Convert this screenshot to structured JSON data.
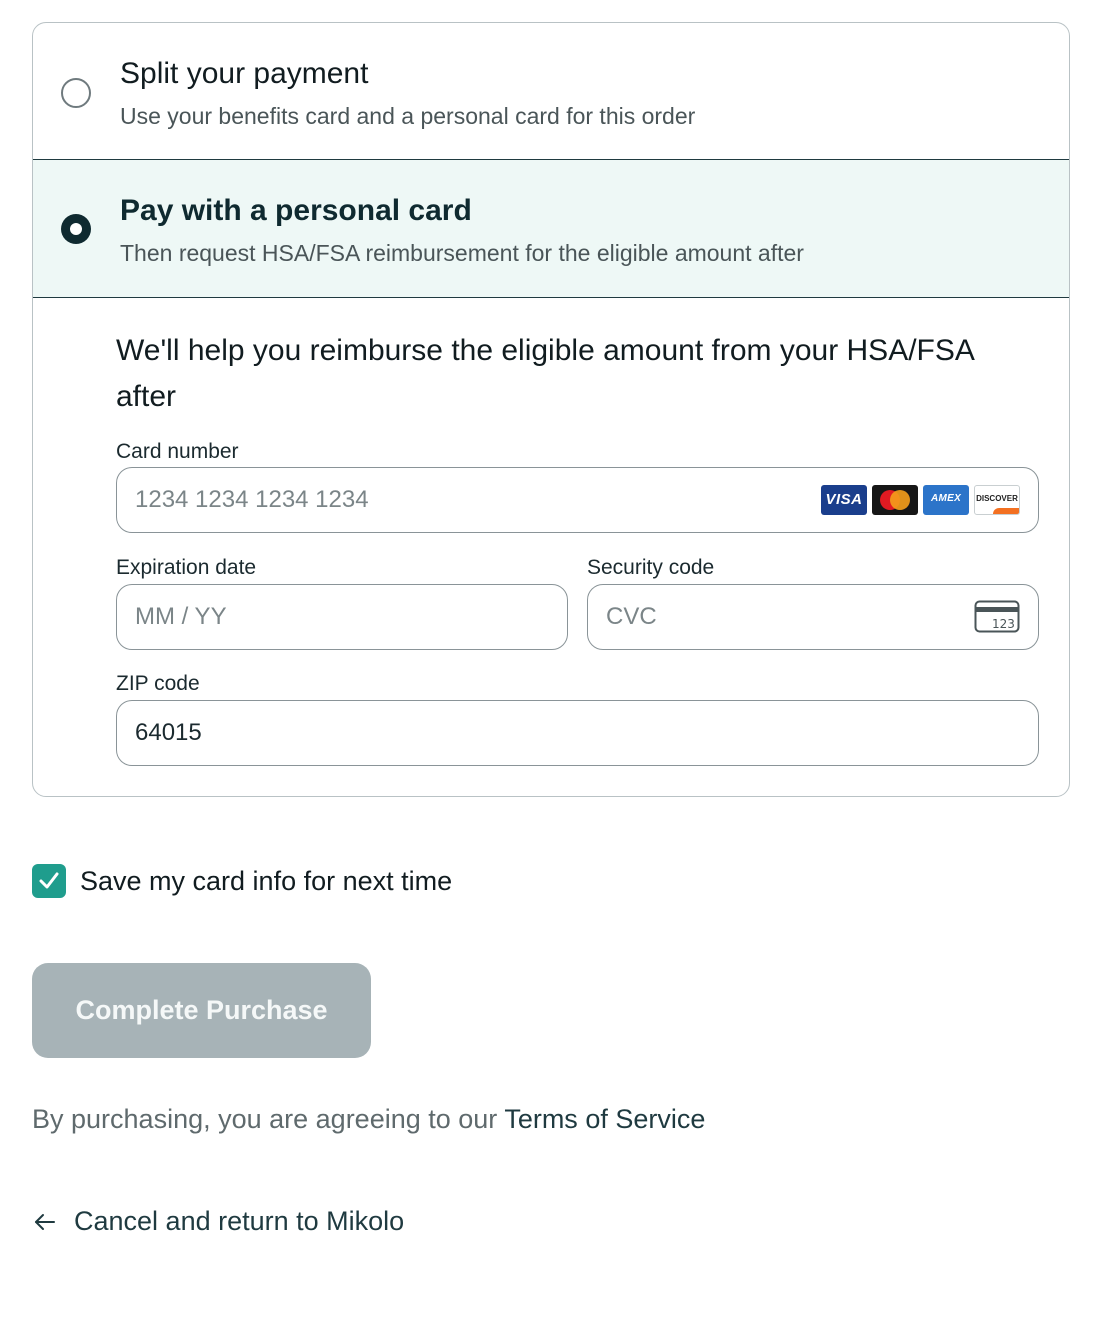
{
  "payment_options": {
    "split": {
      "title": "Split your payment",
      "description": "Use your benefits card and a personal card for this order",
      "selected": false
    },
    "personal": {
      "title": "Pay with a personal card",
      "description": "Then request HSA/FSA reimbursement for the eligible amount after",
      "selected": true
    }
  },
  "card_form": {
    "heading": "We'll help you reimburse the eligible amount from your HSA/FSA after",
    "card_number": {
      "label": "Card number",
      "placeholder": "1234 1234 1234 1234",
      "value": ""
    },
    "card_brands": [
      "VISA",
      "AMEX",
      "DISCOVER"
    ],
    "expiration": {
      "label": "Expiration date",
      "placeholder": "MM / YY",
      "value": ""
    },
    "security_code": {
      "label": "Security code",
      "placeholder": "CVC",
      "value": "",
      "icon_text": "123"
    },
    "zip": {
      "label": "ZIP code",
      "value": "64015"
    }
  },
  "save_card": {
    "label": "Save my card info for next time",
    "checked": true
  },
  "purchase_button": {
    "label": "Complete Purchase"
  },
  "terms": {
    "prefix": "By purchasing, you are agreeing to our ",
    "link": "Terms of Service"
  },
  "cancel": {
    "label": "Cancel and return to Mikolo"
  },
  "colors": {
    "selected_bg": "#eef8f6",
    "accent": "#1f9d8d",
    "dark": "#0f2a30",
    "disabled_button": "#a7b3b7"
  }
}
